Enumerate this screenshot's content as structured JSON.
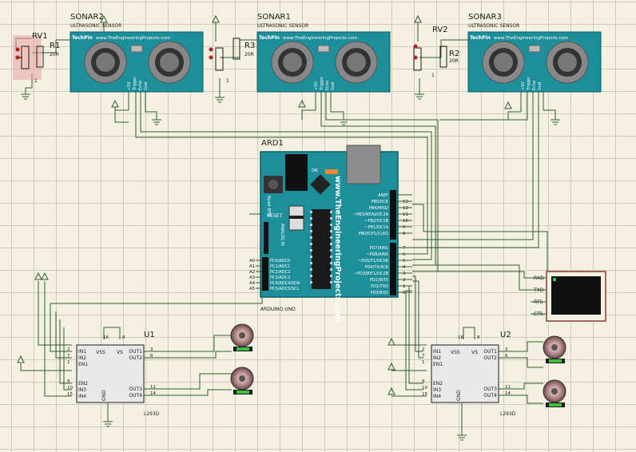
{
  "sonar2": {
    "ref": "SONAR2",
    "sub": "ULTRASONIC SENSOR",
    "brand": "TechPin",
    "url": "www.TheEngineeringProjects.com",
    "pins": [
      "+5V",
      "Trigger",
      "Echo",
      "Gnd"
    ]
  },
  "sonar1": {
    "ref": "SONAR1",
    "sub": "ULTRASONIC SENSOR",
    "brand": "TechPin",
    "url": "www.TheEngineeringProjects.com",
    "pins": [
      "+5V",
      "Trigger",
      "Echo",
      "Gnd"
    ]
  },
  "sonar3": {
    "ref": "SONAR3",
    "sub": "ULTRASONIC SENSOR",
    "brand": "TechPin",
    "url": "www.TheEngineeringProjects.com",
    "pins": [
      "+5V",
      "Trigger",
      "Echo",
      "Gnd"
    ]
  },
  "pots": [
    {
      "ref": "RV1",
      "res": "R1",
      "val": "20R",
      "pin": "1"
    },
    {
      "ref": "",
      "res": "R3",
      "val": "20R",
      "pin": "1"
    },
    {
      "ref": "RV2",
      "res": "R2",
      "val": "20R",
      "pin": "1"
    }
  ],
  "arduino": {
    "ref": "ARD1",
    "name": "ARDUINO UNO",
    "url": "www.TheEngineeringProjects.com",
    "reset": "Reset BTN",
    "on": "ON",
    "reset_pin": "RESET",
    "analog": "ANALOG IN",
    "digital": [
      {
        "n": "",
        "label": "AREF"
      },
      {
        "n": "13",
        "label": "PB5/SCK"
      },
      {
        "n": "12",
        "label": "PB4/MISO"
      },
      {
        "n": "11",
        "label": "~PB3/MOSI/OC2A"
      },
      {
        "n": "10",
        "label": "~PB2/OC1B"
      },
      {
        "n": "9",
        "label": "~PB1/OC1A"
      },
      {
        "n": "8",
        "label": "PB0/ICP1/CLKO"
      },
      {
        "n": "7",
        "label": "PD7/AIN1"
      },
      {
        "n": "6",
        "label": "~PD6/AIN0"
      },
      {
        "n": "5",
        "label": "~PD5/T1/OC0B"
      },
      {
        "n": "4",
        "label": "PD4/T0/XCK"
      },
      {
        "n": "3",
        "label": "~PD3/INT1/OC2B"
      },
      {
        "n": "2",
        "label": "PD2/INT0"
      },
      {
        "n": "1",
        "label": "PD1/TXD"
      },
      {
        "n": "0",
        "label": "PD0/RXD"
      }
    ],
    "analog_pins": [
      {
        "n": "A0",
        "label": "PC0/ADC0"
      },
      {
        "n": "A1",
        "label": "PC1/ADC1"
      },
      {
        "n": "A2",
        "label": "PC2/ADC2"
      },
      {
        "n": "A3",
        "label": "PC3/ADC3"
      },
      {
        "n": "A4",
        "label": "PC4/ADC4/SDA"
      },
      {
        "n": "A5",
        "label": "PC5/ADC5/SCL"
      }
    ]
  },
  "u1": {
    "ref": "U1",
    "part": "L293D",
    "left": [
      {
        "n": "2",
        "l": "IN1"
      },
      {
        "n": "7",
        "l": "IN2"
      },
      {
        "n": "1",
        "l": "EN1"
      },
      {
        "n": "9",
        "l": "EN2"
      },
      {
        "n": "10",
        "l": "IN3"
      },
      {
        "n": "15",
        "l": "IN4"
      }
    ],
    "right": [
      {
        "n": "3",
        "l": "OUT1"
      },
      {
        "n": "6",
        "l": "OUT2"
      },
      {
        "n": "11",
        "l": "OUT3"
      },
      {
        "n": "14",
        "l": "OUT4"
      }
    ],
    "top": [
      {
        "n": "16",
        "l": "VSS"
      },
      {
        "n": "8",
        "l": "VS"
      }
    ],
    "gnd": "GND"
  },
  "u2": {
    "ref": "U2",
    "part": "L293D",
    "left": [
      {
        "n": "2",
        "l": "IN1"
      },
      {
        "n": "7",
        "l": "IN2"
      },
      {
        "n": "1",
        "l": "EN1"
      },
      {
        "n": "9",
        "l": "EN2"
      },
      {
        "n": "10",
        "l": "IN3"
      },
      {
        "n": "15",
        "l": "IN4"
      }
    ],
    "right": [
      {
        "n": "3",
        "l": "OUT1"
      },
      {
        "n": "6",
        "l": "OUT2"
      },
      {
        "n": "11",
        "l": "OUT3"
      },
      {
        "n": "14",
        "l": "OUT4"
      }
    ],
    "top": [
      {
        "n": "16",
        "l": "VSS"
      },
      {
        "n": "8",
        "l": "VS"
      }
    ],
    "gnd": "GND"
  },
  "terminal": {
    "pins": [
      "RXD",
      "TXD",
      "RTS",
      "CTS"
    ]
  },
  "colors": {
    "board": "#1d8f9b",
    "board_edge": "#0f5e66",
    "wire": "#2f5a2f",
    "chip": "#e9e9e9",
    "grid": "#cfcbbb",
    "bg": "#f4f1e2",
    "led": "#3cc23c"
  }
}
